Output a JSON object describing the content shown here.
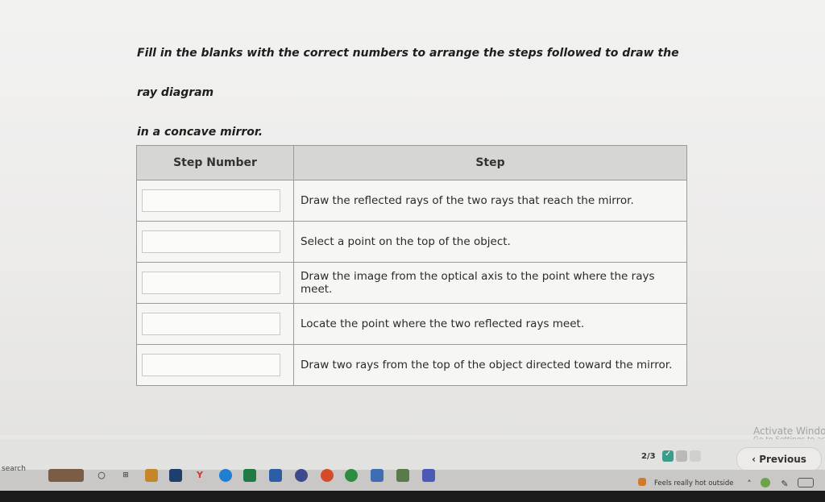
{
  "question": {
    "line1": "Fill in the blanks with the correct numbers to arrange the steps followed to draw the ray diagram",
    "line2": "in a concave mirror."
  },
  "table": {
    "headers": [
      "Step Number",
      "Step"
    ],
    "rows": [
      {
        "step": "Draw the reflected rays of the two rays that reach the mirror."
      },
      {
        "step": "Select a point on the top of the object."
      },
      {
        "step": "Draw the image from the optical axis to the point where the rays meet."
      },
      {
        "step": "Locate the point where the two reflected rays meet."
      },
      {
        "step": "Draw two rays from the top of the object directed toward the mirror."
      }
    ]
  },
  "navigation": {
    "page_indicator": "2/3",
    "previous_label": "Previous",
    "previous_icon": "chevron-left-icon"
  },
  "windows_watermark": {
    "line1": "Activate Windo",
    "line2": "Go to Settings to ac"
  },
  "taskbar": {
    "search_text": "search",
    "weather_text": "Feels really hot outside"
  },
  "colors": {
    "progress_done": "#3a9d8a",
    "header_bg": "#d6d6d4"
  }
}
